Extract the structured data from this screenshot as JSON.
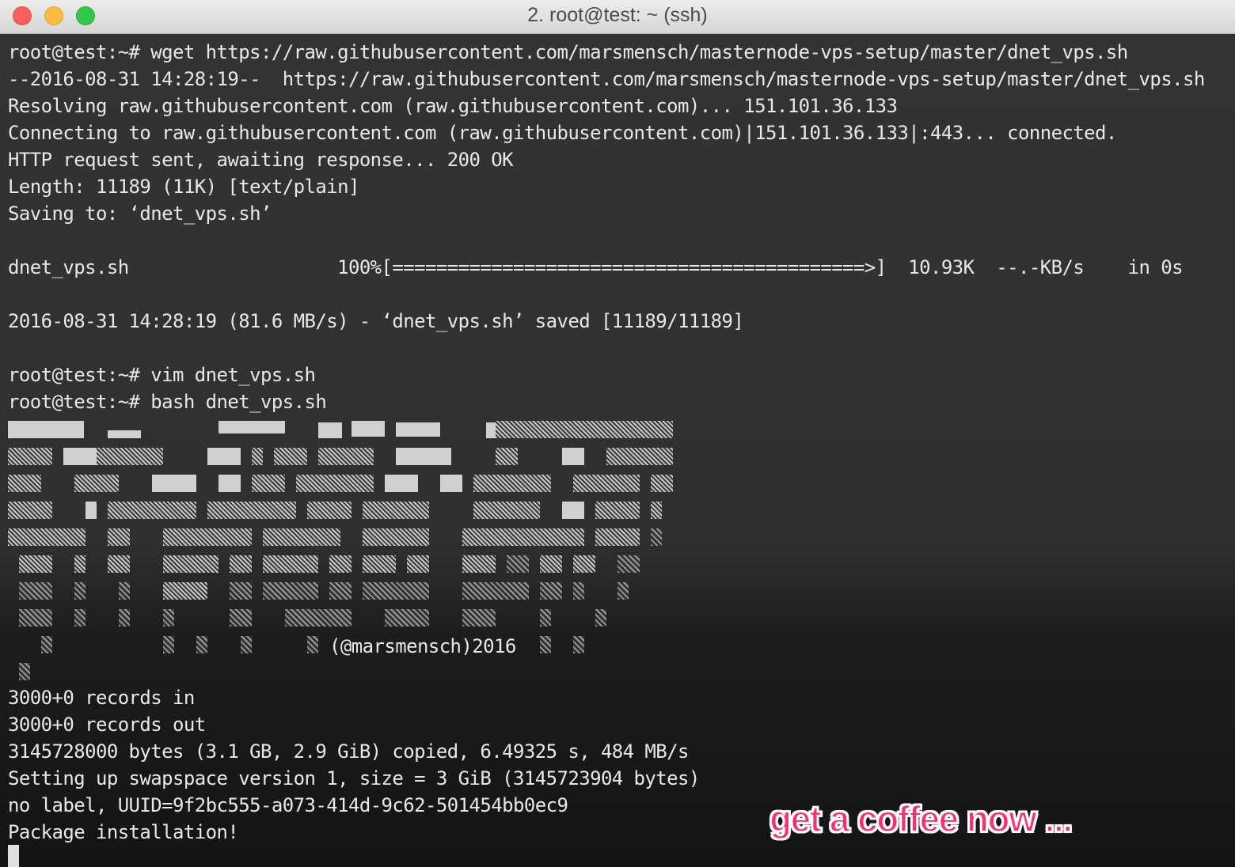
{
  "window": {
    "title": "2. root@test: ~ (ssh)",
    "buttons": [
      "close",
      "minimize",
      "zoom"
    ]
  },
  "terminal": {
    "lines": [
      "root@test:~# wget https://raw.githubusercontent.com/marsmensch/masternode-vps-setup/master/dnet_vps.sh",
      "--2016-08-31 14:28:19--  https://raw.githubusercontent.com/marsmensch/masternode-vps-setup/master/dnet_vps.sh",
      "Resolving raw.githubusercontent.com (raw.githubusercontent.com)... 151.101.36.133",
      "Connecting to raw.githubusercontent.com (raw.githubusercontent.com)|151.101.36.133|:443... connected.",
      "HTTP request sent, awaiting response... 200 OK",
      "Length: 11189 (11K) [text/plain]",
      "Saving to: ‘dnet_vps.sh’",
      "",
      "dnet_vps.sh                   100%[===========================================>]  10.93K  --.-KB/s    in 0s",
      "",
      "2016-08-31 14:28:19 (81.6 MB/s) - ‘dnet_vps.sh’ saved [11189/11189]",
      "",
      "root@test:~# vim dnet_vps.sh",
      "root@test:~# bash dnet_vps.sh"
    ],
    "art_credit": "(@marsmensch)2016",
    "lines_after": [
      "3000+0 records in",
      "3000+0 records out",
      "3145728000 bytes (3.1 GB, 2.9 GiB) copied, 6.49325 s, 484 MB/s",
      "Setting up swapspace version 1, size = 3 GiB (3145723904 bytes)",
      "no label, UUID=9f2bc555-a073-414d-9c62-501454bb0ec9",
      "Package installation!"
    ]
  },
  "overlay": {
    "caption": "get a coffee now ...",
    "caption_color": "#ff2f6d"
  },
  "colors": {
    "terminal_bg": "#333333",
    "terminal_text": "#e8e8e8",
    "titlebar_bg": "#e3e3e3"
  }
}
